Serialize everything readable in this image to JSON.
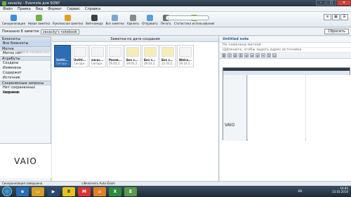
{
  "window": {
    "title": "zavacky - Evernote для SONY"
  },
  "menu": [
    "Файл",
    "Правка",
    "Вид",
    "Формат",
    "Сервис",
    "Справка"
  ],
  "toolbar": {
    "buttons": [
      {
        "label": "Синхронизация",
        "color": "#3d8fd6"
      },
      {
        "label": "Новая заметка",
        "color": "#6cb33f"
      },
      {
        "label": "Рукописная заметка",
        "color": "#e0a020"
      },
      {
        "label": "Веб-камера",
        "color": "#404040"
      },
      {
        "label": "Все заметки",
        "color": "#7aa6d0"
      },
      {
        "label": "Удалить",
        "color": "#8a8a8a"
      },
      {
        "label": "Отправить",
        "color": "#5aa0d8"
      },
      {
        "label": "Печать",
        "color": "#707070"
      },
      {
        "label": "Статистика использования",
        "color": "#9ab040"
      }
    ],
    "search_placeholder": "Поиск"
  },
  "filter": {
    "shown": "Показано 8 заметок",
    "notebook": "zavacky's notebook",
    "reset": "Сбросить"
  },
  "sidebar": {
    "notebooks_header": "Блокноты",
    "notebook": "Все блокноты",
    "tags_header": "Метки",
    "no_tags": "Меток нет",
    "attributes_header": "Атрибуты",
    "attributes": [
      "Создана",
      "Изменена",
      "Содержит",
      "Источник"
    ],
    "saved_header": "Сохраненные запросы",
    "no_saved": "Нет сохраненных запросов",
    "trash": "Корзина",
    "logo": "VAIO"
  },
  "notes": {
    "header": "Заметки по дате создания",
    "items": [
      {
        "title": "Untitl...",
        "date": "Сегодн..."
      },
      {
        "title": "Untitl...",
        "date": "Сегодн..."
      },
      {
        "title": "zavac...",
        "date": "Сегодн..."
      },
      {
        "title": "Распи...",
        "date": "29.03.2..."
      },
      {
        "title": "Без з...",
        "date": "29.03.2..."
      },
      {
        "title": "Без з...",
        "date": "29.03.2..."
      },
      {
        "title": "Без з...",
        "date": "22.03.2..."
      },
      {
        "title": "Welco...",
        "date": "29.10.2..."
      }
    ]
  },
  "note_view": {
    "title": "Untitled note",
    "tags": "Не помечена меткой",
    "source": "Щёлкните, чтобы задать адрес источника"
  },
  "status": {
    "text": "Синхронизация завершена",
    "zoom": "Включить Auto-Zoom"
  },
  "watermark": "mobile-review.com",
  "taskbar": {
    "lang": "EN",
    "time": "14:41",
    "date": "23.03.2010",
    "apps": [
      "IE",
      "Explorer",
      "Media",
      "Yandex",
      "Mobile",
      "Office",
      "Excel"
    ]
  }
}
